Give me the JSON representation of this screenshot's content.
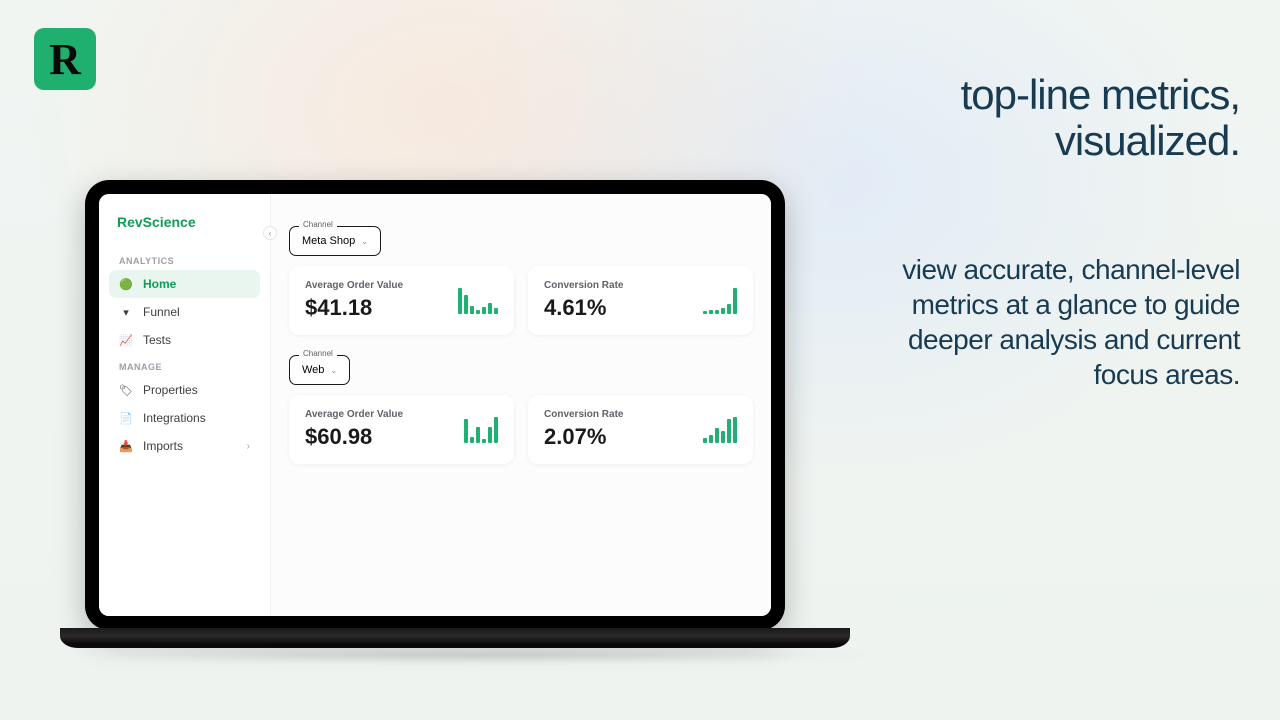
{
  "logo": {
    "letter": "R"
  },
  "marketing": {
    "headline_line1": "top-line metrics,",
    "headline_line2": "visualized.",
    "body": "view accurate, channel-level metrics at a glance to guide deeper analysis and current focus areas."
  },
  "app": {
    "brand": "RevScience",
    "sections": {
      "analytics": {
        "label": "ANALYTICS"
      },
      "manage": {
        "label": "MANAGE"
      }
    },
    "nav": {
      "home": "Home",
      "funnel": "Funnel",
      "tests": "Tests",
      "properties": "Properties",
      "integrations": "Integrations",
      "imports": "Imports"
    },
    "channels": [
      {
        "label": "Channel",
        "selected": "Meta Shop",
        "metrics": {
          "aov": {
            "label": "Average Order Value",
            "value": "$41.18",
            "spark": [
              20,
              14,
              6,
              3,
              5,
              8,
              4
            ]
          },
          "cr": {
            "label": "Conversion Rate",
            "value": "4.61%",
            "spark": [
              2,
              3,
              3,
              5,
              8,
              22
            ]
          }
        }
      },
      {
        "label": "Channel",
        "selected": "Web",
        "metrics": {
          "aov": {
            "label": "Average Order Value",
            "value": "$60.98",
            "spark": [
              18,
              4,
              12,
              3,
              12,
              20
            ]
          },
          "cr": {
            "label": "Conversion Rate",
            "value": "2.07%",
            "spark": [
              4,
              6,
              12,
              10,
              20,
              22
            ]
          }
        }
      }
    ]
  },
  "chart_data": [
    {
      "type": "bar",
      "title": "Average Order Value — Meta Shop",
      "values": [
        20,
        14,
        6,
        3,
        5,
        8,
        4
      ],
      "ylabel": "relative height"
    },
    {
      "type": "bar",
      "title": "Conversion Rate — Meta Shop",
      "values": [
        2,
        3,
        3,
        5,
        8,
        22
      ],
      "ylabel": "relative height"
    },
    {
      "type": "bar",
      "title": "Average Order Value — Web",
      "values": [
        18,
        4,
        12,
        3,
        12,
        20
      ],
      "ylabel": "relative height"
    },
    {
      "type": "bar",
      "title": "Conversion Rate — Web",
      "values": [
        4,
        6,
        12,
        10,
        20,
        22
      ],
      "ylabel": "relative height"
    }
  ]
}
